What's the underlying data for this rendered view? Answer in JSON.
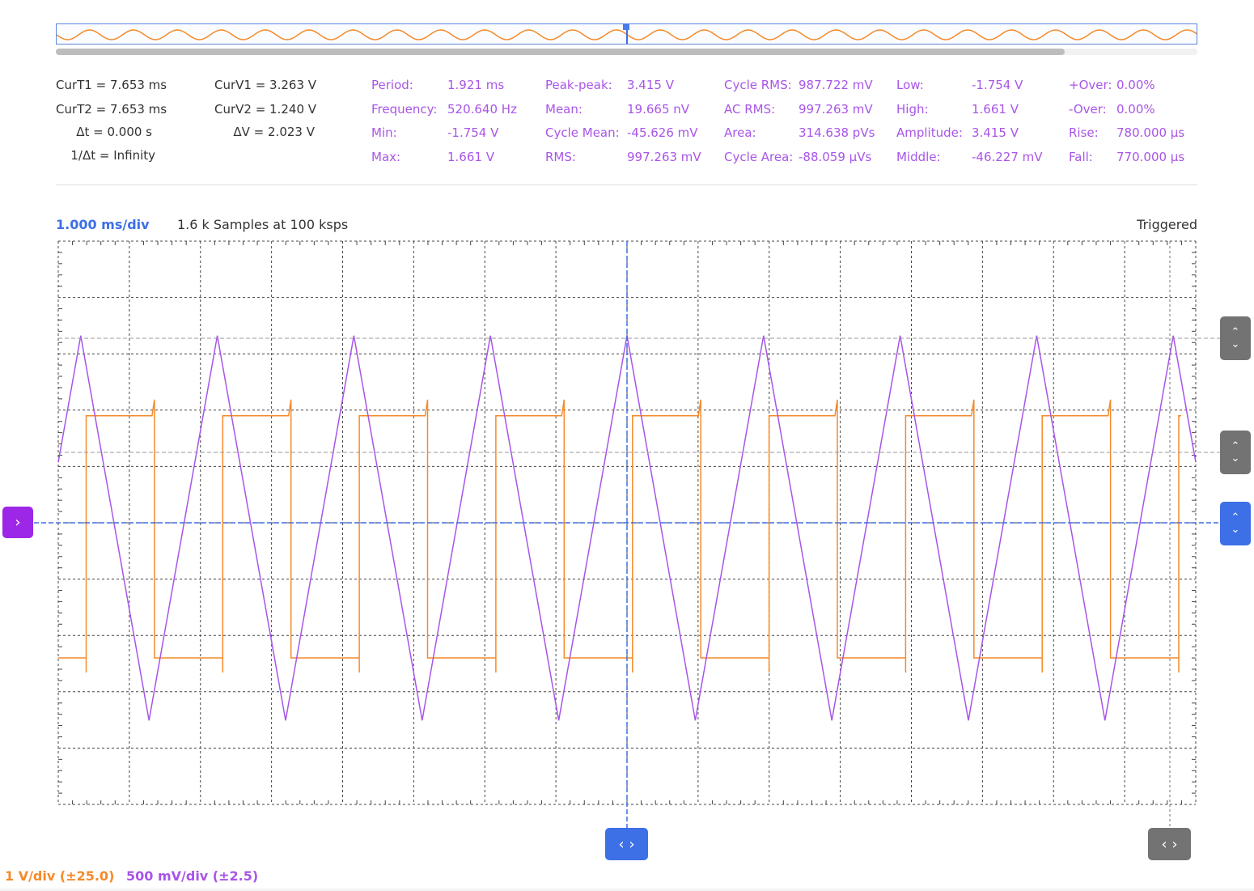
{
  "cursors": {
    "t1": "CurT1 = 7.653 ms",
    "t2": "CurT2 = 7.653 ms",
    "dt": "Δt = 0.000 s",
    "inv_dt": "1/Δt = Infinity",
    "v1": "CurV1 = 3.263 V",
    "v2": "CurV2 = 1.240 V",
    "dv": "ΔV = 2.023 V"
  },
  "measurements": [
    [
      {
        "label": "Period:",
        "value": "1.921 ms"
      },
      {
        "label": "Frequency:",
        "value": "520.640 Hz"
      },
      {
        "label": "Min:",
        "value": "-1.754 V"
      },
      {
        "label": "Max:",
        "value": "1.661 V"
      }
    ],
    [
      {
        "label": "Peak-peak:",
        "value": "3.415 V"
      },
      {
        "label": "Mean:",
        "value": "19.665 nV"
      },
      {
        "label": "Cycle Mean:",
        "value": "-45.626 mV"
      },
      {
        "label": "RMS:",
        "value": "997.263 mV"
      }
    ],
    [
      {
        "label": "Cycle RMS:",
        "value": "987.722 mV"
      },
      {
        "label": "AC RMS:",
        "value": "997.263 mV"
      },
      {
        "label": "Area:",
        "value": "314.638 pVs"
      },
      {
        "label": "Cycle Area:",
        "value": "-88.059 μVs"
      }
    ],
    [
      {
        "label": "Low:",
        "value": "-1.754 V"
      },
      {
        "label": "High:",
        "value": "1.661 V"
      },
      {
        "label": "Amplitude:",
        "value": "3.415 V"
      },
      {
        "label": "Middle:",
        "value": "-46.227 mV"
      }
    ],
    [
      {
        "label": "+Over:",
        "value": "0.00%"
      },
      {
        "label": "-Over:",
        "value": "0.00%"
      },
      {
        "label": "Rise:",
        "value": "780.000 μs"
      },
      {
        "label": "Fall:",
        "value": "770.000 μs"
      }
    ]
  ],
  "status": {
    "time_div": "1.000 ms/div",
    "samples": "1.6 k Samples at 100 ksps",
    "trigger_state": "Triggered"
  },
  "channels": {
    "ch1": {
      "scale": "1 V/div (±25.0)",
      "color": "#f48a2a"
    },
    "ch2": {
      "scale": "500 mV/div (±2.5)",
      "color": "#a855e8"
    }
  },
  "colors": {
    "grid": "#444444",
    "trigger": "#3d6fe6",
    "handle_grey": "#737373"
  },
  "icons": {
    "ch2_offset_handle": "chevron-right-icon",
    "level_handle": "chevron-up-down-icon",
    "time_handle": "chevron-left-right-icon"
  },
  "chart_data": {
    "type": "line",
    "grid": true,
    "x_unit": "ms",
    "time_per_div_ms": 1.0,
    "x_range_ms": [
      0,
      16
    ],
    "series": [
      {
        "channel": "ch1",
        "waveform": "square",
        "period_ms": 1.921,
        "high_div": 1.9,
        "low_div": -2.4,
        "volts_per_div": 1.0
      },
      {
        "channel": "ch2",
        "waveform": "triangle",
        "period_ms": 1.921,
        "max_v": 1.661,
        "min_v": -1.754,
        "volts_per_div": 0.5
      }
    ]
  }
}
